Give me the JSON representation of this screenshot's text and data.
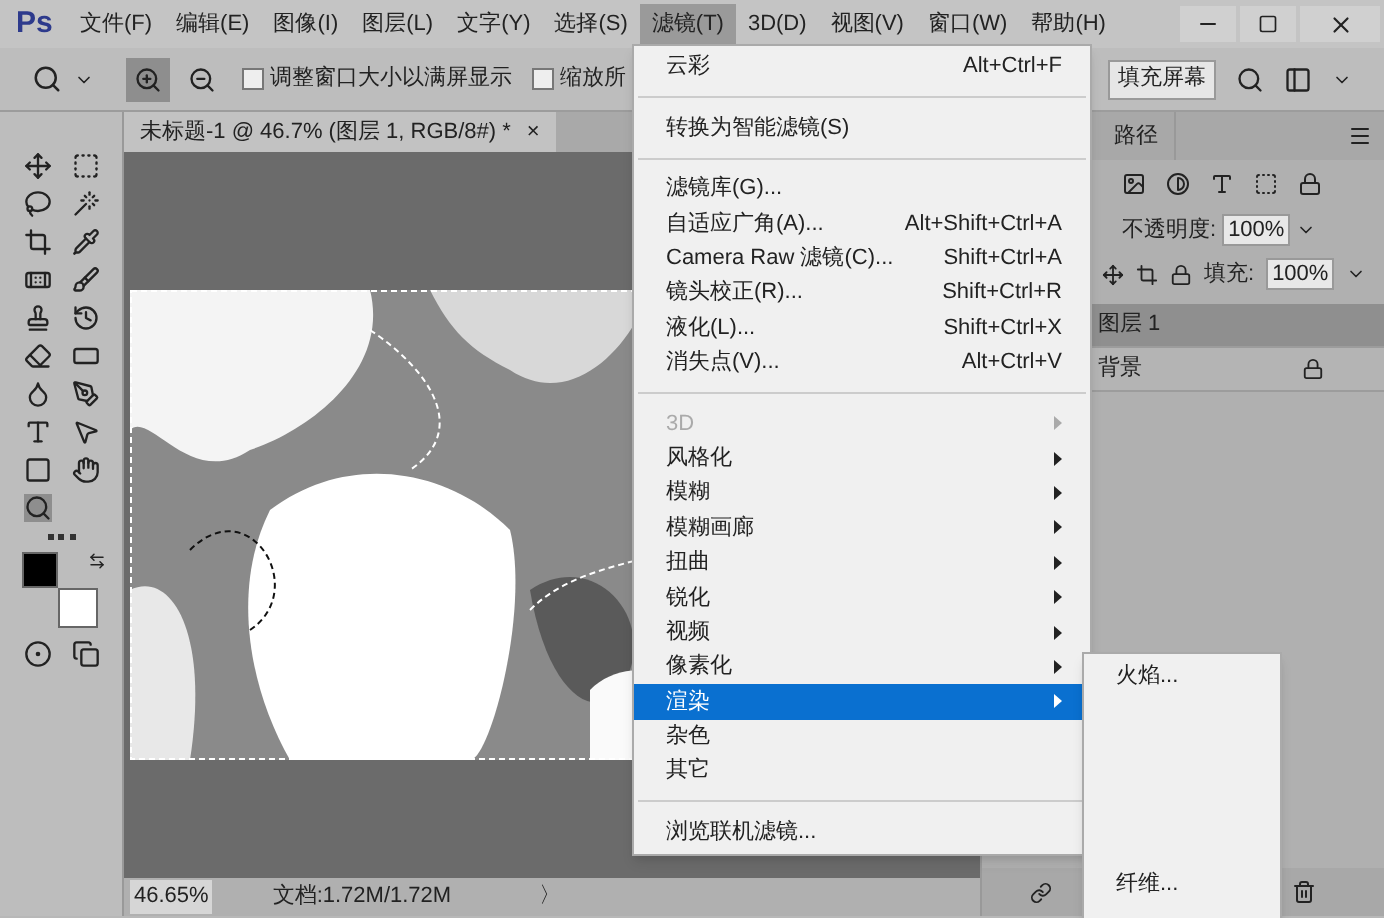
{
  "app_logo": "Ps",
  "menu_bar": [
    {
      "label": "文件(F)",
      "selected": false
    },
    {
      "label": "编辑(E)",
      "selected": false
    },
    {
      "label": "图像(I)",
      "selected": false
    },
    {
      "label": "图层(L)",
      "selected": false
    },
    {
      "label": "文字(Y)",
      "selected": false
    },
    {
      "label": "选择(S)",
      "selected": false
    },
    {
      "label": "滤镜(T)",
      "selected": true
    },
    {
      "label": "3D(D)",
      "selected": false
    },
    {
      "label": "视图(V)",
      "selected": false
    },
    {
      "label": "窗口(W)",
      "selected": false
    },
    {
      "label": "帮助(H)",
      "selected": false
    }
  ],
  "options_bar": {
    "checkboxes": [
      {
        "label": "调整窗口大小以满屏显示",
        "checked": false
      },
      {
        "label": "缩放所",
        "checked": false
      }
    ],
    "button": "填充屏幕"
  },
  "document_tab": {
    "title": "未标题-1 @ 46.7% (图层 1, RGB/8#) *",
    "close": "×"
  },
  "status_bar": {
    "zoom": "46.65%",
    "doc": "文档:1.72M/1.72M",
    "arrow": "〉"
  },
  "layers_panel": {
    "tab": "路径",
    "opacity_label": "不透明度:",
    "opacity": "100%",
    "fill_label": "填充:",
    "fill": "100%",
    "layers": [
      {
        "name": "图层 1",
        "selected": true,
        "locked": false
      },
      {
        "name": "背景",
        "selected": false,
        "locked": true
      }
    ]
  },
  "filter_menu": [
    {
      "kind": "item",
      "label": "云彩",
      "shortcut": "Alt+Ctrl+F",
      "disabled": false,
      "selected": false
    },
    {
      "kind": "separator"
    },
    {
      "kind": "item",
      "label": "转换为智能滤镜(S)",
      "disabled": false,
      "selected": false
    },
    {
      "kind": "separator"
    },
    {
      "kind": "item",
      "label": "滤镜库(G)...",
      "disabled": false,
      "selected": false
    },
    {
      "kind": "item",
      "label": "自适应广角(A)...",
      "shortcut": "Alt+Shift+Ctrl+A",
      "disabled": false,
      "selected": false
    },
    {
      "kind": "item",
      "label": "Camera Raw 滤镜(C)...",
      "shortcut": "Shift+Ctrl+A",
      "disabled": false,
      "selected": false
    },
    {
      "kind": "item",
      "label": "镜头校正(R)...",
      "shortcut": "Shift+Ctrl+R",
      "disabled": false,
      "selected": false
    },
    {
      "kind": "item",
      "label": "液化(L)...",
      "shortcut": "Shift+Ctrl+X",
      "disabled": false,
      "selected": false
    },
    {
      "kind": "item",
      "label": "消失点(V)...",
      "shortcut": "Alt+Ctrl+V",
      "disabled": false,
      "selected": false
    },
    {
      "kind": "separator"
    },
    {
      "kind": "submenu",
      "label": "3D",
      "disabled": true,
      "selected": false
    },
    {
      "kind": "submenu",
      "label": "风格化",
      "disabled": false,
      "selected": false
    },
    {
      "kind": "submenu",
      "label": "模糊",
      "disabled": false,
      "selected": false
    },
    {
      "kind": "submenu",
      "label": "模糊画廊",
      "disabled": false,
      "selected": false
    },
    {
      "kind": "submenu",
      "label": "扭曲",
      "disabled": false,
      "selected": false
    },
    {
      "kind": "submenu",
      "label": "锐化",
      "disabled": false,
      "selected": false
    },
    {
      "kind": "submenu",
      "label": "视频",
      "disabled": false,
      "selected": false
    },
    {
      "kind": "submenu",
      "label": "像素化",
      "disabled": false,
      "selected": false
    },
    {
      "kind": "submenu",
      "label": "渲染",
      "disabled": false,
      "selected": true
    },
    {
      "kind": "item",
      "label": "杂色",
      "disabled": false,
      "selected": false
    },
    {
      "kind": "item",
      "label": "其它",
      "disabled": false,
      "selected": false
    },
    {
      "kind": "separator"
    },
    {
      "kind": "item",
      "label": "浏览联机滤镜...",
      "disabled": false,
      "selected": false
    }
  ],
  "render_submenu": [
    "火焰...",
    "纤维..."
  ]
}
